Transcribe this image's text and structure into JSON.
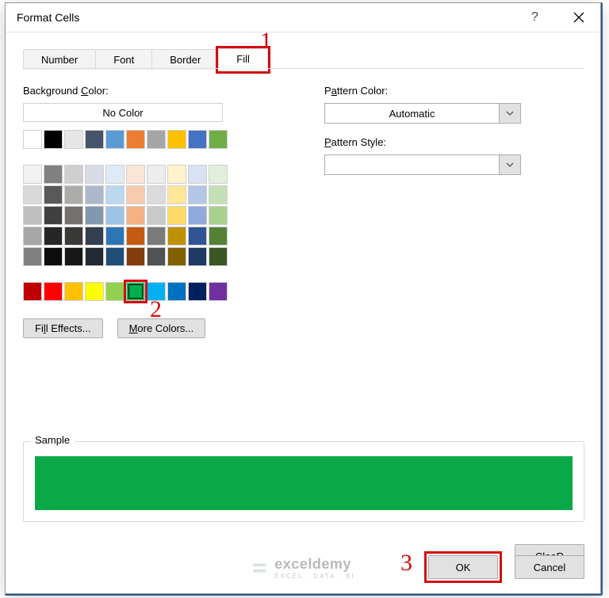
{
  "dialog": {
    "title": "Format Cells",
    "help_icon": "?",
    "close_icon": "✕",
    "tabs": [
      "Number",
      "Font",
      "Border",
      "Fill"
    ],
    "active_tab_index": 3
  },
  "left": {
    "bgcolor_label_pre": "Background ",
    "bgcolor_label_u": "C",
    "bgcolor_label_post": "olor:",
    "no_color_label": "No Color",
    "fill_effects_pre": "Fi",
    "fill_effects_u": "l",
    "fill_effects_post": "l Effects...",
    "more_colors_u": "M",
    "more_colors_post": "ore Colors..."
  },
  "right": {
    "pcolor_pre": "P",
    "pcolor_u": "a",
    "pcolor_post": "ttern Color:",
    "pcolor_value": "Automatic",
    "pstyle_u": "P",
    "pstyle_post": "attern Style:",
    "pstyle_value": ""
  },
  "sample": {
    "label": "Sample",
    "color": "#0aa847"
  },
  "buttons": {
    "clear_u": "R",
    "clear_rest_pre": "Clea",
    "clear_rest_post": "",
    "ok": "OK",
    "cancel": "Cancel"
  },
  "callouts": {
    "n1": "1",
    "n2": "2",
    "n3": "3"
  },
  "watermark": {
    "main": "exceldemy",
    "sub": "EXCEL · DATA · BI"
  },
  "palette": {
    "row1": [
      "#ffffff",
      "#000000",
      "#e7e6e6",
      "#44546a",
      "#5b9bd5",
      "#ed7d31",
      "#a5a5a5",
      "#ffc000",
      "#4472c4",
      "#70ad47"
    ],
    "theme": [
      [
        "#f2f2f2",
        "#808080",
        "#d0cece",
        "#d6dce5",
        "#deebf7",
        "#fbe5d6",
        "#ededed",
        "#fff2cc",
        "#d9e2f3",
        "#e2efda"
      ],
      [
        "#d9d9d9",
        "#595959",
        "#aeabab",
        "#adb9ca",
        "#bdd7ee",
        "#f8cbad",
        "#dbdbdb",
        "#ffe699",
        "#b4c7e7",
        "#c5e0b4"
      ],
      [
        "#bfbfbf",
        "#404040",
        "#757171",
        "#8497b0",
        "#9dc3e6",
        "#f4b183",
        "#c9c9c9",
        "#ffd966",
        "#8faadc",
        "#a9d18e"
      ],
      [
        "#a6a6a6",
        "#262626",
        "#3b3838",
        "#333f50",
        "#2e75b6",
        "#c55a11",
        "#7b7b7b",
        "#bf9000",
        "#2f5597",
        "#548235"
      ],
      [
        "#808080",
        "#0d0d0d",
        "#181717",
        "#222a35",
        "#1f4e79",
        "#843c0c",
        "#525252",
        "#806000",
        "#203864",
        "#385723"
      ]
    ],
    "standard": [
      "#c00000",
      "#ff0000",
      "#ffc000",
      "#ffff00",
      "#92d050",
      "#00b050",
      "#00b0f0",
      "#0070c0",
      "#002060",
      "#7030a0"
    ],
    "selected_standard_index": 5
  }
}
